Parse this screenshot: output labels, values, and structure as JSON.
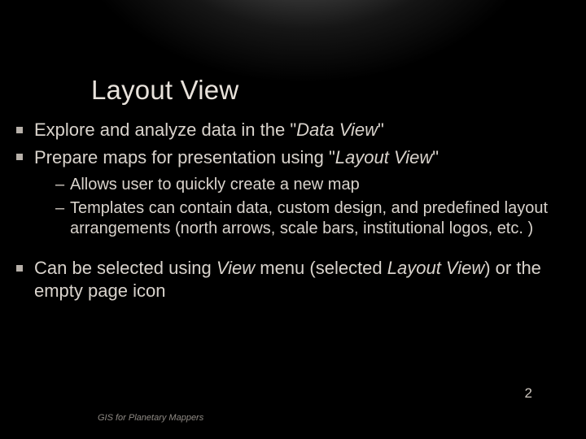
{
  "title": "Layout View",
  "bullets": {
    "b1_pre": "Explore and analyze data in the \"",
    "b1_em": "Data View",
    "b1_post": "\"",
    "b2_pre": "Prepare maps for presentation using \"",
    "b2_em": "Layout View",
    "b2_post": "\"",
    "s1": "Allows user to quickly create a new map",
    "s2": "Templates can contain data, custom design, and predefined layout arrangements (north arrows, scale bars, institutional logos, etc. )",
    "b3_pre": "Can be selected using ",
    "b3_em1": "View",
    "b3_mid": " menu (selected ",
    "b3_em2": "Layout View",
    "b3_post": ") or the empty page icon"
  },
  "footer": "GIS for Planetary Mappers",
  "page_number": "2"
}
